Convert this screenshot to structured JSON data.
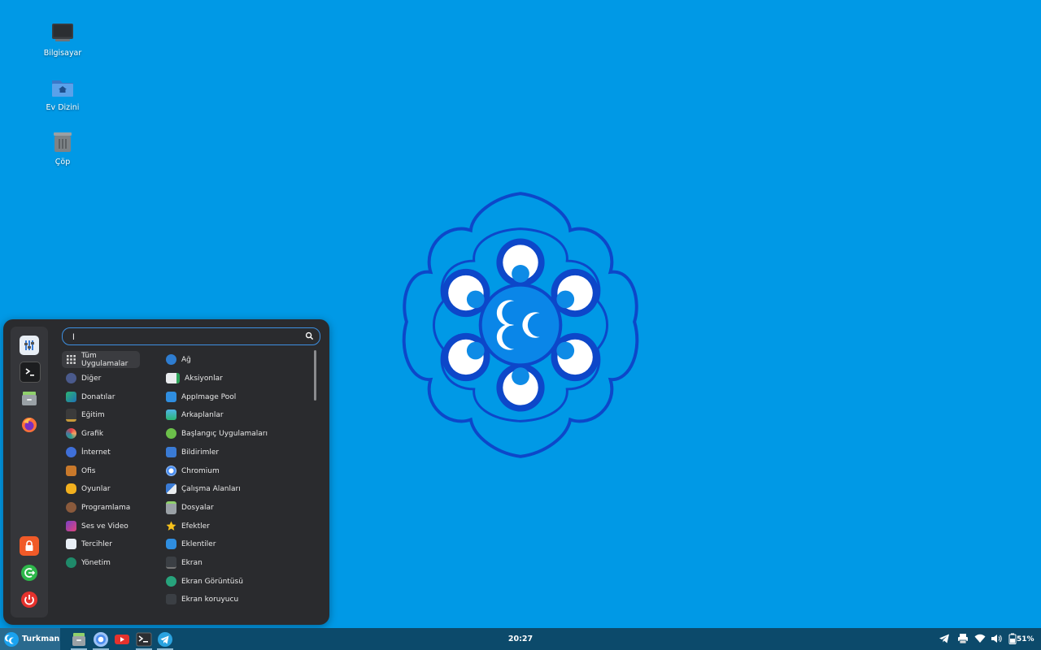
{
  "desktop": {
    "icons": [
      {
        "label": "Bilgisayar",
        "icon": "computer-icon"
      },
      {
        "label": "Ev Dizini",
        "icon": "home-folder-icon"
      },
      {
        "label": "Çöp",
        "icon": "trash-icon"
      }
    ],
    "wallpaper_color": "#0099e6"
  },
  "menu": {
    "search": {
      "value": "l",
      "placeholder": ""
    },
    "sidebar": [
      "settings-icon",
      "terminal-icon",
      "files-icon",
      "firefox-icon",
      "lock-icon",
      "logout-icon",
      "power-icon"
    ],
    "categories": [
      {
        "label": "Tüm Uygulamalar",
        "icon": "grid-icon",
        "active": true
      },
      {
        "label": "Diğer",
        "icon": "more-icon"
      },
      {
        "label": "Donatılar",
        "icon": "accessories-icon"
      },
      {
        "label": "Eğitim",
        "icon": "education-icon"
      },
      {
        "label": "Grafik",
        "icon": "graphics-icon"
      },
      {
        "label": "İnternet",
        "icon": "internet-icon"
      },
      {
        "label": "Ofis",
        "icon": "office-icon"
      },
      {
        "label": "Oyunlar",
        "icon": "games-icon"
      },
      {
        "label": "Programlama",
        "icon": "programming-icon"
      },
      {
        "label": "Ses ve Video",
        "icon": "multimedia-icon"
      },
      {
        "label": "Tercihler",
        "icon": "preferences-icon"
      },
      {
        "label": "Yönetim",
        "icon": "administration-icon"
      }
    ],
    "apps": [
      {
        "label": "Ağ",
        "icon": "network-icon"
      },
      {
        "label": "Aksiyonlar",
        "icon": "actions-icon"
      },
      {
        "label": "AppImage Pool",
        "icon": "appimage-icon"
      },
      {
        "label": "Arkaplanlar",
        "icon": "backgrounds-icon"
      },
      {
        "label": "Başlangıç Uygulamaları",
        "icon": "startup-icon"
      },
      {
        "label": "Bildirimler",
        "icon": "notifications-icon"
      },
      {
        "label": "Chromium",
        "icon": "chromium-icon"
      },
      {
        "label": "Çalışma Alanları",
        "icon": "workspaces-icon"
      },
      {
        "label": "Dosyalar",
        "icon": "files-icon"
      },
      {
        "label": "Efektler",
        "icon": "effects-icon"
      },
      {
        "label": "Eklentiler",
        "icon": "plugins-icon"
      },
      {
        "label": "Ekran",
        "icon": "display-icon"
      },
      {
        "label": "Ekran Görüntüsü",
        "icon": "screenshot-icon"
      },
      {
        "label": "Ekran koruyucu",
        "icon": "screensaver-icon"
      }
    ]
  },
  "taskbar": {
    "start_label": "Turkman",
    "launchers": [
      "files-icon",
      "chromium-icon",
      "youtube-icon",
      "terminal-icon",
      "telegram-icon"
    ],
    "clock": "20:27",
    "tray": [
      "telegram-tray-icon",
      "printer-icon",
      "wifi-icon",
      "volume-icon",
      "battery-icon"
    ],
    "battery": "51%"
  }
}
